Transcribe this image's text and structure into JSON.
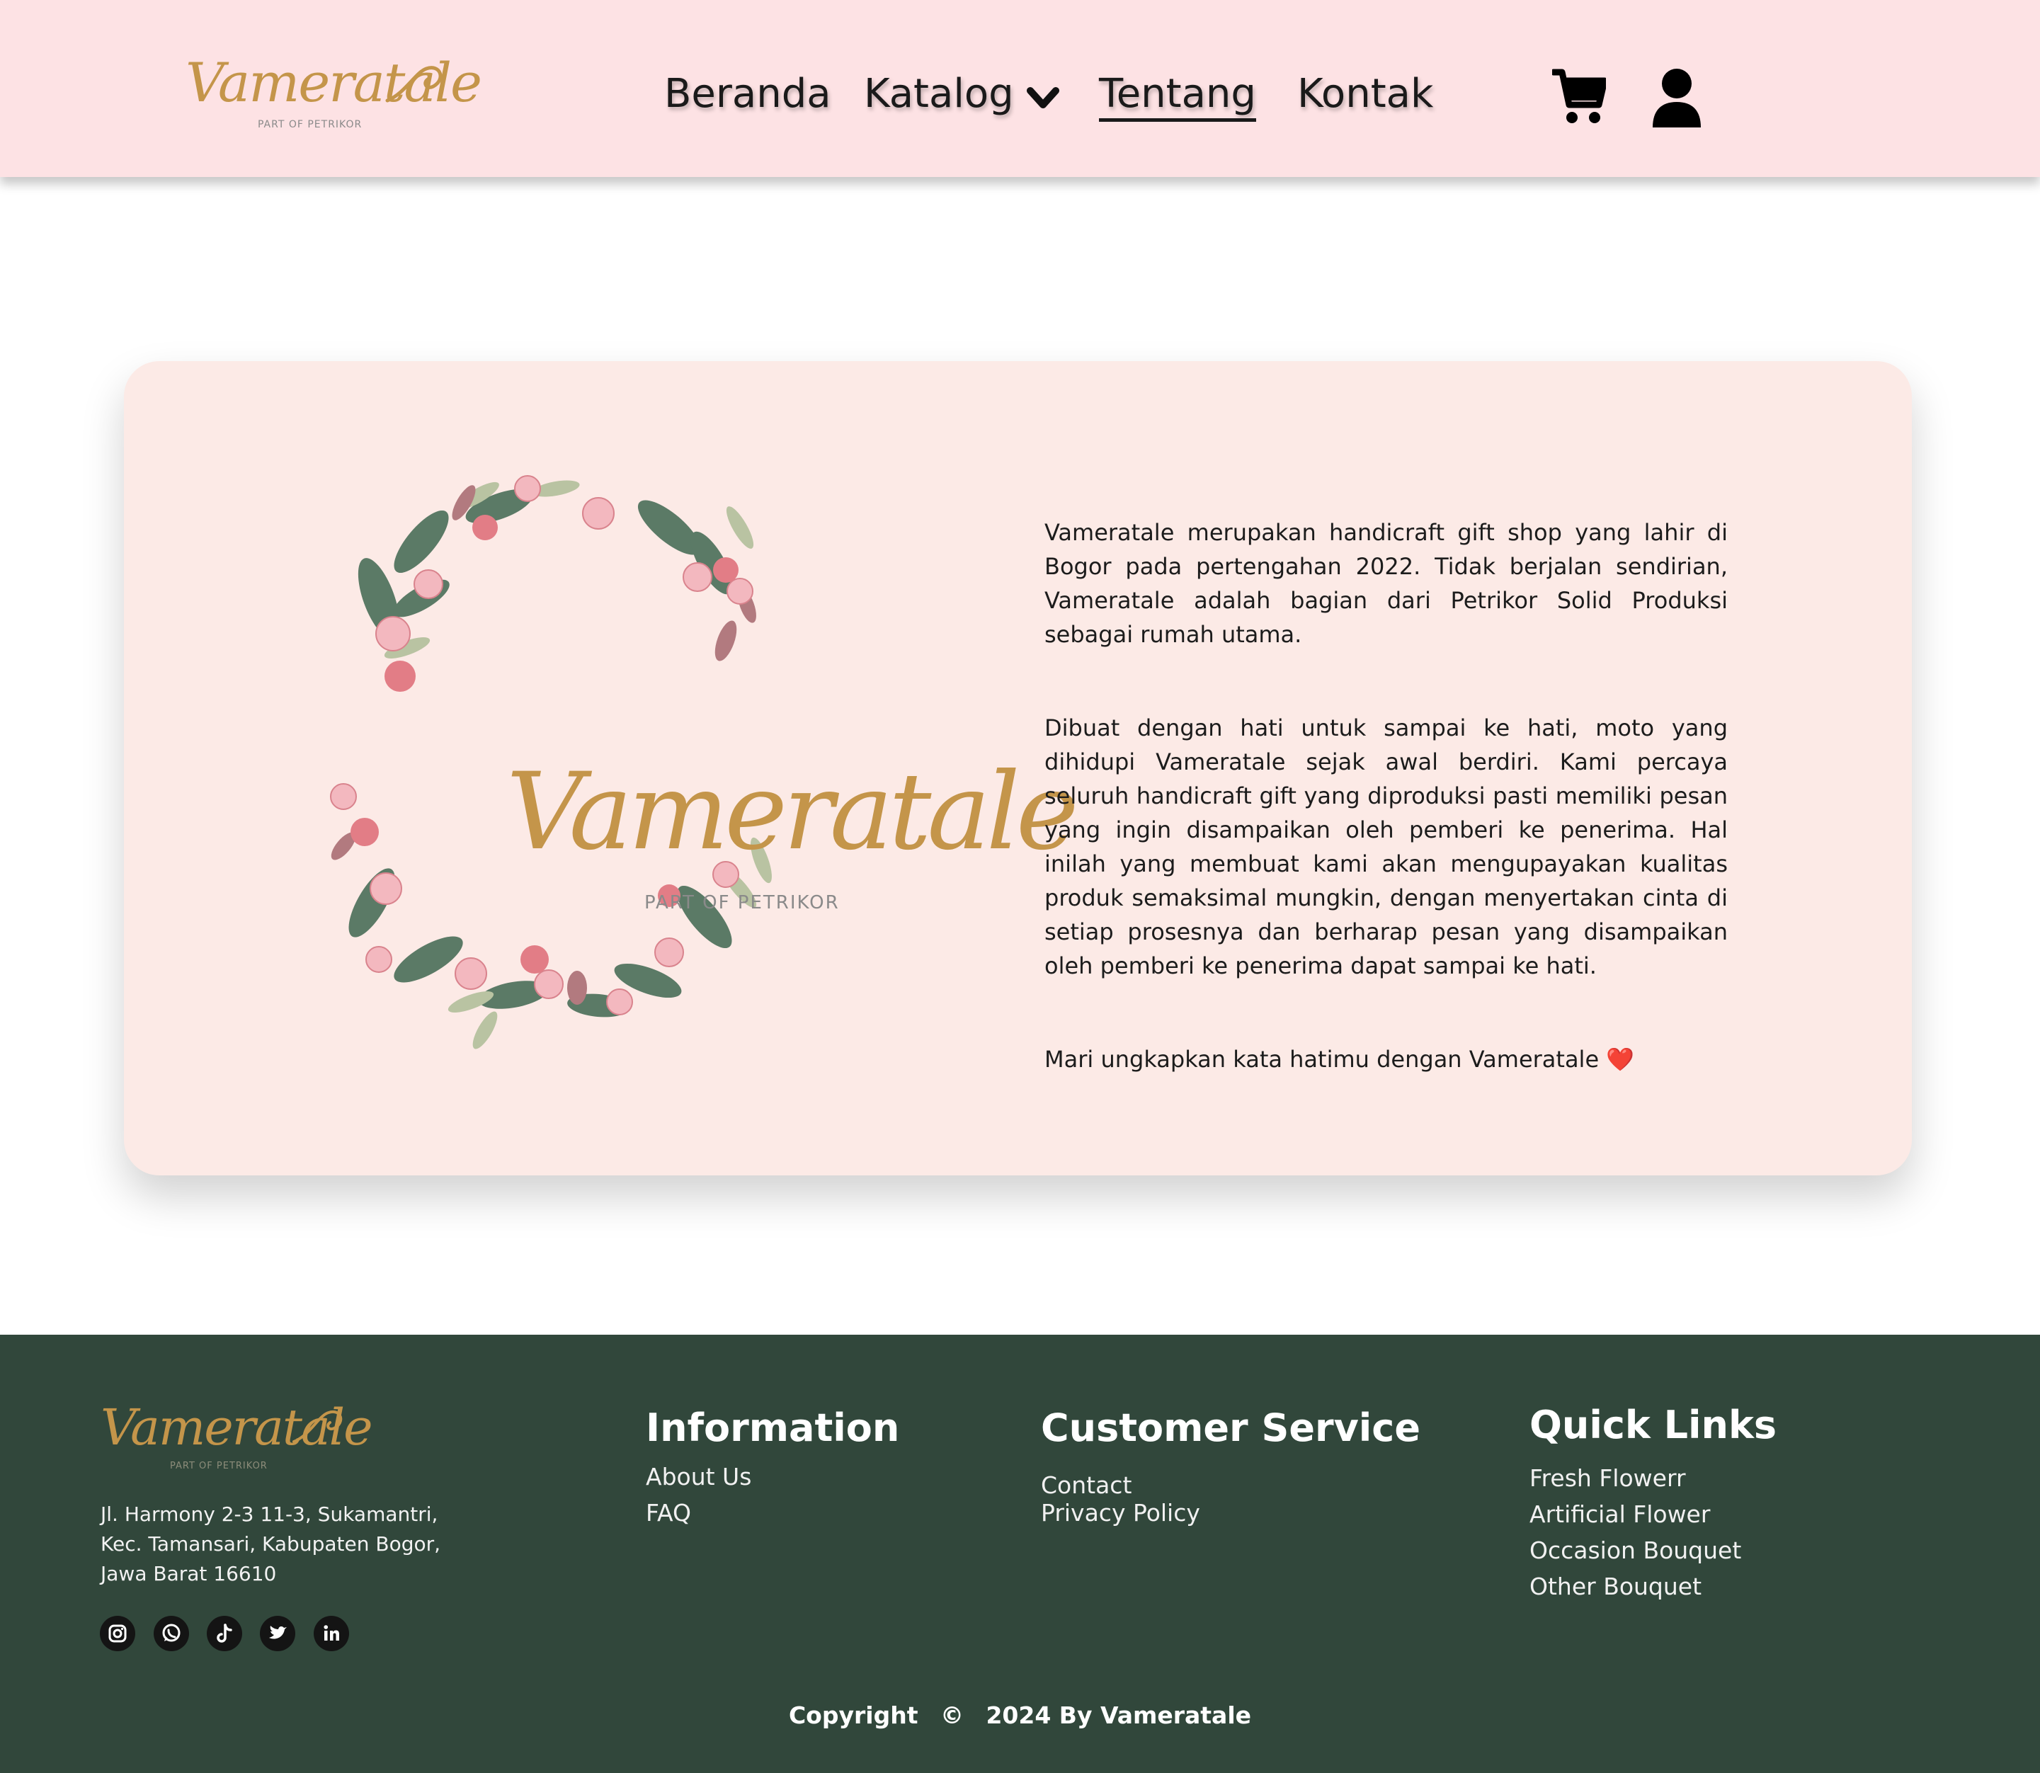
{
  "brand": {
    "logo_text": "Vameratale",
    "logo_subtitle": "PART OF PETRIKOR",
    "gold_color": "#c4954a"
  },
  "nav": {
    "items": [
      {
        "label": "Beranda"
      },
      {
        "label": "Katalog"
      },
      {
        "label": "Tentang",
        "active": true
      },
      {
        "label": "Kontak"
      }
    ],
    "icons": [
      "chevron-down-icon",
      "cart-icon",
      "user-icon"
    ]
  },
  "about": {
    "paragraphs": [
      "Vameratale merupakan handicraft gift shop yang lahir di Bogor pada pertengahan 2022. Tidak berjalan sendirian, Vameratale adalah bagian dari Petrikor Solid Produksi sebagai rumah utama.",
      "Dibuat dengan hati untuk sampai ke hati, moto yang dihidupi Vameratale sejak awal berdiri. Kami percaya seluruh handicraft gift yang diproduksi pasti memiliki pesan yang ingin disampaikan oleh pemberi ke penerima. Hal inilah yang membuat kami akan mengupayakan kualitas produk semaksimal mungkin, dengan menyertakan cinta di setiap prosesnya dan berharap pesan yang disampaikan oleh pemberi ke penerima dapat sampai ke hati."
    ],
    "closing": "Mari ungkapkan kata hatimu dengan Vameratale",
    "closing_emoji": "❤️"
  },
  "footer": {
    "address": [
      "Jl. Harmony 2-3 11-3, Sukamantri,",
      "Kec. Tamansari, Kabupaten Bogor,",
      "Jawa Barat 16610"
    ],
    "social_icons": [
      "instagram-icon",
      "whatsapp-icon",
      "tiktok-icon",
      "twitter-icon",
      "linkedin-icon"
    ],
    "information": {
      "heading": "Information",
      "links": [
        "About Us",
        "FAQ"
      ]
    },
    "customer_service": {
      "heading": "Customer Service",
      "links": [
        "Contact",
        "Privacy Policy"
      ]
    },
    "quick_links": {
      "heading": "Quick Links",
      "links": [
        "Fresh Flowerr",
        "Artificial Flower",
        "Occasion Bouquet",
        "Other Bouquet"
      ]
    },
    "copyright": {
      "prefix": "Copyright",
      "symbol": "©",
      "text": "2024 By Vameratale"
    },
    "background": "#31473b"
  }
}
